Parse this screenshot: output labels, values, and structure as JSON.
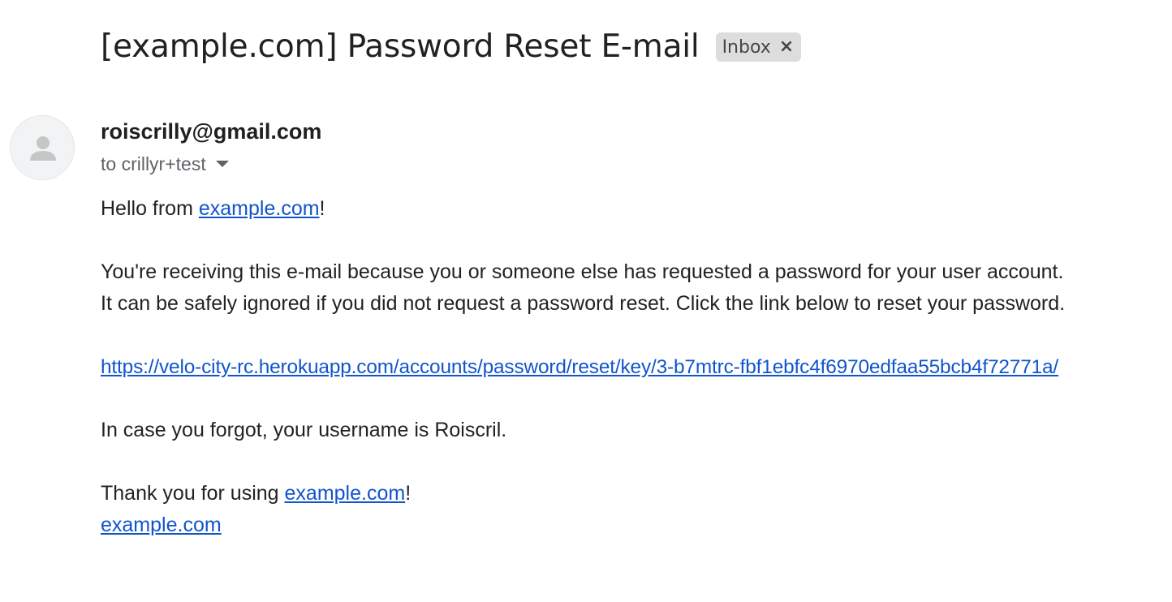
{
  "email": {
    "subject": "[example.com] Password Reset E-mail",
    "label": {
      "text": "Inbox",
      "close_icon": "close-icon",
      "close_glyph": "×"
    },
    "sender": "roiscrilly@gmail.com",
    "recipient": "to crillyr+test",
    "avatar_icon": "person-icon",
    "body": {
      "greeting_prefix": "Hello from ",
      "greeting_link": "example.com",
      "greeting_suffix": "!",
      "line1": "You're receiving this e-mail because you or someone else has requested a password for your user account.",
      "line2": "It can be safely ignored if you did not request a password reset. Click the link below to reset your password.",
      "reset_link": "https://velo-city-rc.herokuapp.com/accounts/password/reset/key/3-b7mtrc-fbf1ebfc4f6970edfaa55bcb4f72771a/",
      "username_line": "In case you forgot, your username is Roiscril.",
      "thanks_prefix": "Thank you for using ",
      "thanks_link": "example.com",
      "thanks_suffix": "!",
      "signature_link": "example.com"
    }
  },
  "colors": {
    "link": "#1155cc",
    "chip_background": "#dddddd",
    "avatar_background": "#f1f3f4",
    "avatar_figure": "#c4c7c5"
  }
}
